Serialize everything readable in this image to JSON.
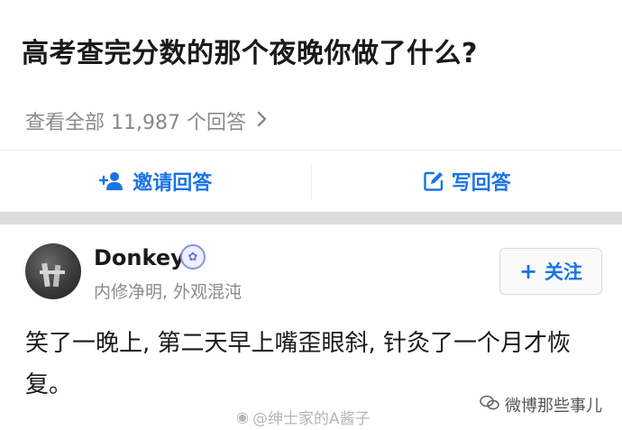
{
  "question": {
    "title": "高考查完分数的那个夜晚你做了什么?"
  },
  "answers_link": {
    "label": "查看全部 11,987 个回答",
    "chevron_icon": "chevron-right-icon"
  },
  "actions": {
    "invite": {
      "label": "邀请回答",
      "icon": "add-user-icon"
    },
    "write": {
      "label": "写回答",
      "icon": "edit-icon"
    }
  },
  "answer": {
    "author_name": "Donkey",
    "author_badge_icon": "verified-badge-icon",
    "author_bio": "内修净明, 外观混沌",
    "follow_label": "关注",
    "body": "笑了一晚上, 第二天早上嘴歪眼斜, 针灸了一个月才恢复。"
  },
  "watermarks": {
    "left": "@绅士家的A酱子",
    "right": "微博那些事儿"
  },
  "colors": {
    "accent": "#1a73e8",
    "muted": "#8a8a8a",
    "band": "#dcdcdc"
  }
}
